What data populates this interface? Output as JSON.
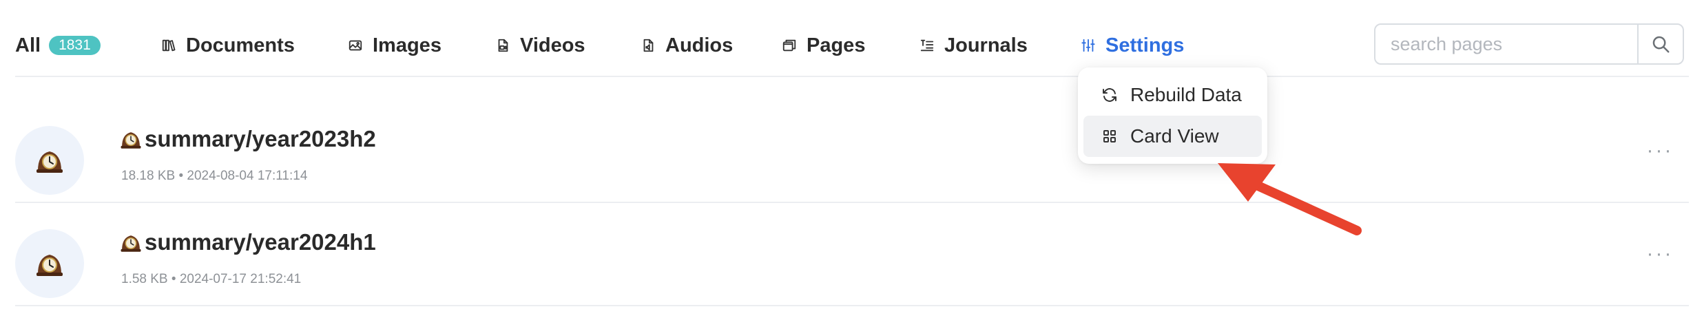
{
  "tabs": [
    {
      "label": "All",
      "count": "1831",
      "icon": "none"
    },
    {
      "label": "Documents",
      "icon": "books-icon"
    },
    {
      "label": "Images",
      "icon": "image-icon"
    },
    {
      "label": "Videos",
      "icon": "video-file-icon"
    },
    {
      "label": "Audios",
      "icon": "audio-file-icon"
    },
    {
      "label": "Pages",
      "icon": "pages-icon"
    },
    {
      "label": "Journals",
      "icon": "journal-icon"
    },
    {
      "label": "Settings",
      "icon": "sliders-icon",
      "active": true
    }
  ],
  "search": {
    "placeholder": "search pages",
    "value": ""
  },
  "settings_menu": {
    "items": [
      {
        "label": "Rebuild Data",
        "icon": "refresh-icon"
      },
      {
        "label": "Card View",
        "icon": "grid-icon"
      }
    ]
  },
  "rows": [
    {
      "title": "summary/year2023h2",
      "size": "18.18 KB",
      "date": "2024-08-04 17:11:14",
      "icon": "mantelpiece-clock-icon",
      "meta": "18.18 KB • 2024-08-04 17:11:14"
    },
    {
      "title": "summary/year2024h1",
      "size": "1.58 KB",
      "date": "2024-07-17 21:52:41",
      "icon": "mantelpiece-clock-icon",
      "meta": "1.58 KB • 2024-07-17 21:52:41"
    }
  ],
  "more_label": "···",
  "colors": {
    "accent": "#2f6fe0",
    "badge": "#4ec3c2",
    "annotation_arrow": "#e8432e",
    "avatar_bg": "#eef3fb",
    "divider": "#eceef1"
  }
}
